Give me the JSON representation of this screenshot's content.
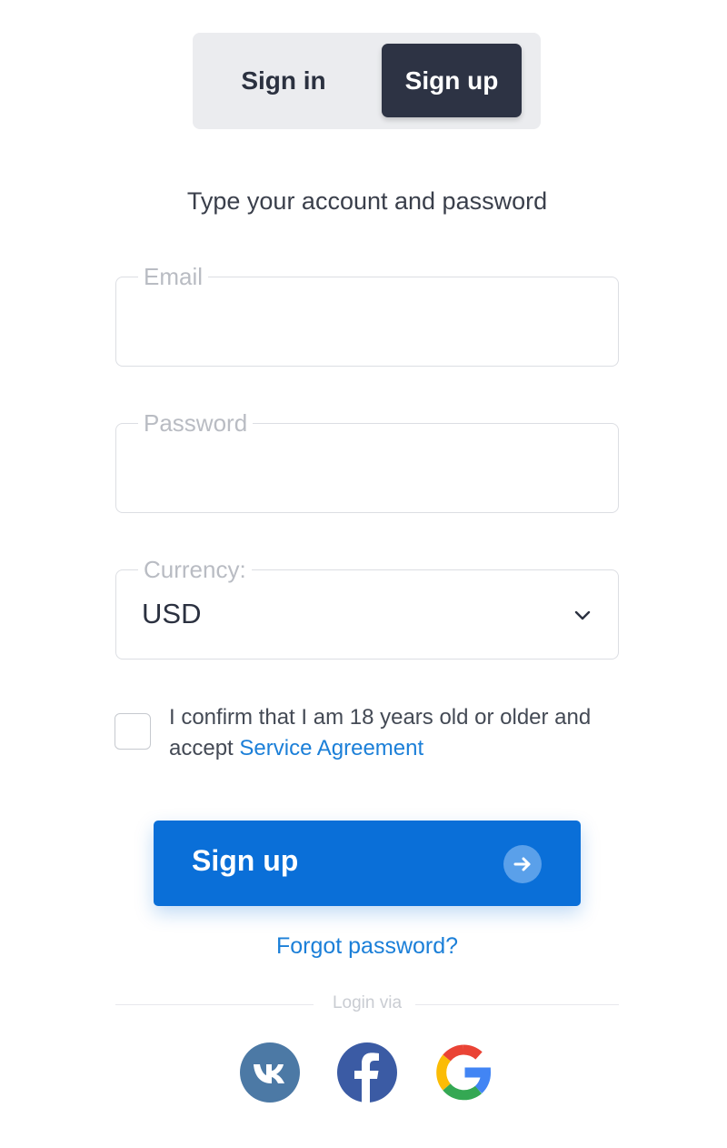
{
  "tabs": {
    "sign_in": "Sign in",
    "sign_up": "Sign up",
    "active": "sign_up"
  },
  "form": {
    "subtitle": "Type your account and password",
    "email_label": "Email",
    "password_label": "Password",
    "currency_label": "Currency:",
    "currency_value": "USD",
    "confirm_text": "I confirm that I am 18 years old or older and accept ",
    "service_agreement_link": "Service Agreement",
    "confirm_checked": false,
    "submit_label": "Sign up",
    "forgot_password": "Forgot password?"
  },
  "social": {
    "divider_label": "Login via",
    "providers": [
      {
        "name": "vk",
        "icon": "vk-icon"
      },
      {
        "name": "facebook",
        "icon": "facebook-icon"
      },
      {
        "name": "google",
        "icon": "google-icon"
      }
    ]
  },
  "colors": {
    "primary_blue": "#0a6fd8",
    "link_blue": "#1b7fd8",
    "dark_tab": "#2d3344"
  }
}
